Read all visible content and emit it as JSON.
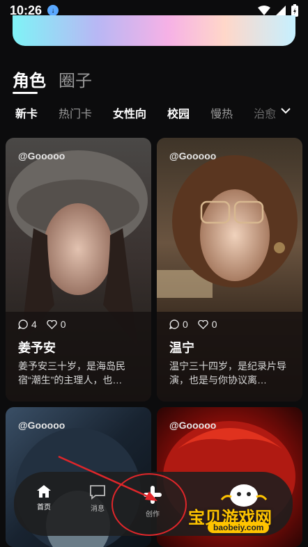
{
  "status_bar": {
    "time": "10:26"
  },
  "main_tabs": [
    {
      "label": "角色",
      "active": true
    },
    {
      "label": "圈子",
      "active": false
    }
  ],
  "sub_tabs": [
    {
      "label": "新卡",
      "active": true
    },
    {
      "label": "热门卡",
      "active": false
    },
    {
      "label": "女性向",
      "active": true
    },
    {
      "label": "校园",
      "active": true
    },
    {
      "label": "慢热",
      "active": false
    },
    {
      "label": "治愈",
      "active": false
    }
  ],
  "cards": [
    {
      "author": "@Gooooo",
      "comments": "4",
      "likes": "0",
      "name": "姜予安",
      "desc": "姜予安三十岁，是海岛民宿“潮生”的主理人，也…"
    },
    {
      "author": "@Gooooo",
      "comments": "0",
      "likes": "0",
      "name": "温宁",
      "desc": "温宁三十四岁，是纪录片导演，也是与你协议离…"
    },
    {
      "author": "@Gooooo"
    },
    {
      "author": "@Gooooo"
    }
  ],
  "bottom_nav": {
    "home": "首页",
    "messages": "消息",
    "create": "创作"
  },
  "watermark": {
    "text": "宝贝游戏网",
    "url": "baobeiy.com"
  },
  "colors": {
    "background": "#0c0c0d",
    "annotation": "#e0262a",
    "watermark": "#ffc400"
  }
}
